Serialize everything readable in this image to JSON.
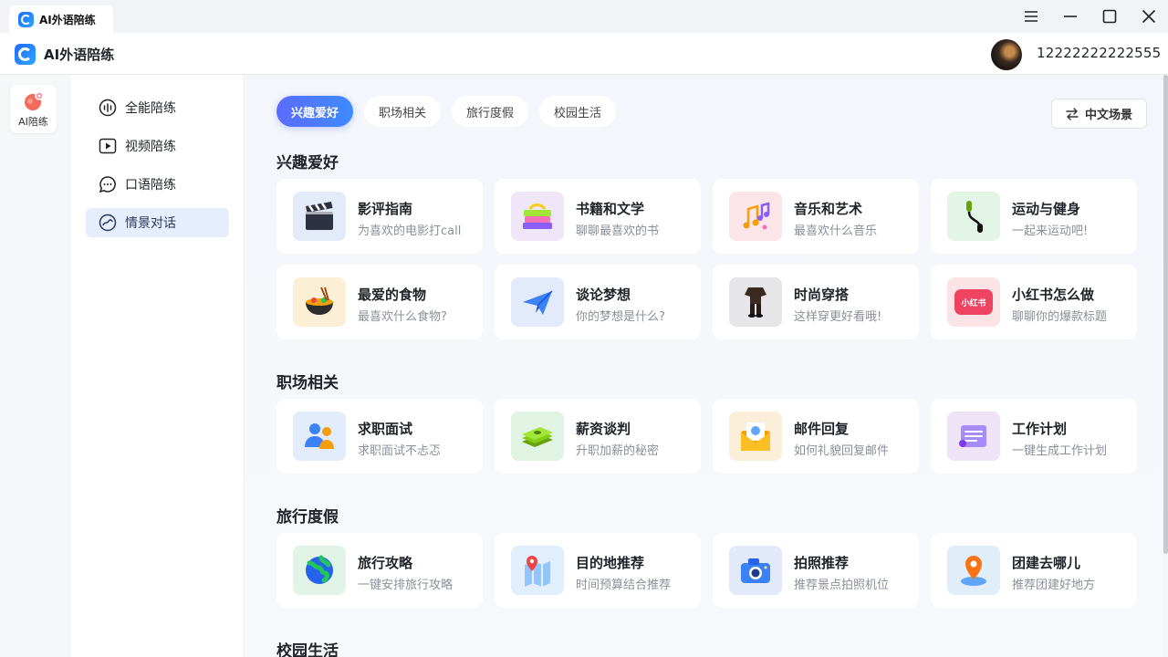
{
  "window": {
    "tab_label": "AI外语陪练",
    "controls": [
      "menu-icon",
      "minimize-icon",
      "maximize-icon",
      "close-icon"
    ]
  },
  "header": {
    "app_title": "AI外语陪练",
    "user_phone": "12222222222555"
  },
  "rail": {
    "item_label": "AI陪练"
  },
  "sidebar": {
    "items": [
      {
        "label": "全能陪练",
        "icon": "waveform-icon"
      },
      {
        "label": "视频陪练",
        "icon": "play-icon"
      },
      {
        "label": "口语陪练",
        "icon": "chat-bubble-icon"
      },
      {
        "label": "情景对话",
        "icon": "scene-chat-icon",
        "active": true
      }
    ]
  },
  "main": {
    "tabs": [
      {
        "label": "兴趣爱好",
        "active": true
      },
      {
        "label": "职场相关"
      },
      {
        "label": "旅行度假"
      },
      {
        "label": "校园生活"
      }
    ],
    "cn_scene_label": "中文场景",
    "sections": [
      {
        "title": "兴趣爱好",
        "cards": [
          {
            "title": "影评指南",
            "subtitle": "为喜欢的电影打call",
            "icon": "clapperboard-icon",
            "bg": "#e4ebf8"
          },
          {
            "title": "书籍和文学",
            "subtitle": "聊聊最喜欢的书",
            "icon": "books-icon",
            "bg": "#efe6f8"
          },
          {
            "title": "音乐和艺术",
            "subtitle": "最喜欢什么音乐",
            "icon": "music-notes-icon",
            "bg": "#fbe5e8"
          },
          {
            "title": "运动与健身",
            "subtitle": "一起来运动吧!",
            "icon": "jump-rope-icon",
            "bg": "#e2f5e6"
          },
          {
            "title": "最爱的食物",
            "subtitle": "最喜欢什么食物?",
            "icon": "noodle-bowl-icon",
            "bg": "#fbf0d6"
          },
          {
            "title": "谈论梦想",
            "subtitle": "你的梦想是什么?",
            "icon": "paper-plane-icon",
            "bg": "#e3eafa"
          },
          {
            "title": "时尚穿搭",
            "subtitle": "这样穿更好看哦!",
            "icon": "outfit-icon",
            "bg": "#e6e6e9"
          },
          {
            "title": "小红书怎么做",
            "subtitle": "聊聊你的爆款标题",
            "icon": "xiaohongshu-icon",
            "bg": "#fbe3e6",
            "badge": "小红书"
          }
        ]
      },
      {
        "title": "职场相关",
        "cards": [
          {
            "title": "求职面试",
            "subtitle": "求职面试不忐忑",
            "icon": "interview-icon",
            "bg": "#e2ecfb"
          },
          {
            "title": "薪资谈判",
            "subtitle": "升职加薪的秘密",
            "icon": "money-stack-icon",
            "bg": "#e1f3e3"
          },
          {
            "title": "邮件回复",
            "subtitle": "如何礼貌回复邮件",
            "icon": "mail-icon",
            "bg": "#fcefd9"
          },
          {
            "title": "工作计划",
            "subtitle": "一键生成工作计划",
            "icon": "plan-scroll-icon",
            "bg": "#efe3f7"
          }
        ]
      },
      {
        "title": "旅行度假",
        "cards": [
          {
            "title": "旅行攻略",
            "subtitle": "一键安排旅行攻略",
            "icon": "globe-icon",
            "bg": "#e2f4e8"
          },
          {
            "title": "目的地推荐",
            "subtitle": "时间预算结合推荐",
            "icon": "map-pin-icon",
            "bg": "#e1eefb"
          },
          {
            "title": "拍照推荐",
            "subtitle": "推荐景点拍照机位",
            "icon": "camera-icon",
            "bg": "#e2e9fa"
          },
          {
            "title": "团建去哪儿",
            "subtitle": "推荐团建好地方",
            "icon": "location-icon",
            "bg": "#e0eefa"
          }
        ]
      },
      {
        "title": "校园生活",
        "cards": []
      }
    ]
  }
}
